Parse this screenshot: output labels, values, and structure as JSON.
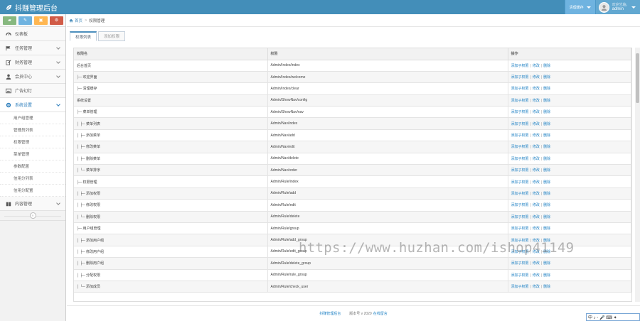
{
  "app": {
    "title": "抖赚管理后台"
  },
  "top": {
    "version_menu": "清理缓存",
    "greeting": "欢迎光临,",
    "username": "admin"
  },
  "colors": {
    "topbar": "#438eb9",
    "shortcut_green": "#87b87f",
    "shortcut_blue": "#6fb3e0",
    "shortcut_orange": "#ffb752",
    "shortcut_red": "#d15b47",
    "link": "#2283c5"
  },
  "shortcuts": [
    {
      "icon": "signal-icon",
      "glyph": "▰"
    },
    {
      "icon": "pencil-icon",
      "glyph": "✎"
    },
    {
      "icon": "group-icon",
      "glyph": "▣"
    },
    {
      "icon": "cog-icon",
      "glyph": "⚙"
    }
  ],
  "sidebar": {
    "dashboard": "仪表板",
    "task": "任务管理",
    "finance": "财务管理",
    "member": "会员中心",
    "ads": "广告幻灯",
    "system": "系统设置",
    "system_items": [
      "用户组管理",
      "管理员列表",
      "权限管理",
      "菜单管理",
      "参数配置",
      "信用分列表",
      "信用分配置"
    ],
    "content": "内容管理",
    "collapse": "«"
  },
  "breadcrumb": {
    "home": "首页",
    "current": "权限管理"
  },
  "tabs": {
    "list": "权限列表",
    "add": "添加权限"
  },
  "table": {
    "headers": [
      "权限名",
      "权限",
      "操作"
    ],
    "ops": {
      "add_child": "添加子权限",
      "edit": "修改",
      "delete": "删除"
    },
    "rows": [
      {
        "name": "后台首页",
        "path": "Admin/Index/index"
      },
      {
        "name": "├─ 欢迎界面",
        "path": "Admin/Index/welcome"
      },
      {
        "name": "├─ 清理缓存",
        "path": "Admin/Index/clear"
      },
      {
        "name": "系统设置",
        "path": "Admin/ShowNav/config"
      },
      {
        "name": "├─ 菜单管理",
        "path": "Admin/ShowNav/nav"
      },
      {
        "name": "│ ├─ 菜单列表",
        "path": "Admin/Nav/index"
      },
      {
        "name": "│ ├─ 添加菜单",
        "path": "Admin/Nav/add"
      },
      {
        "name": "│ ├─ 修改菜单",
        "path": "Admin/Nav/edit"
      },
      {
        "name": "│ ├─ 删除菜单",
        "path": "Admin/Nav/delete"
      },
      {
        "name": "│ └─ 菜单排序",
        "path": "Admin/Nav/order"
      },
      {
        "name": "├─ 权限管理",
        "path": "Admin/Rule/index"
      },
      {
        "name": "│ ├─ 添加权限",
        "path": "Admin/Rule/add"
      },
      {
        "name": "│ ├─ 修改权限",
        "path": "Admin/Rule/edit"
      },
      {
        "name": "│ └─ 删除权限",
        "path": "Admin/Rule/delete"
      },
      {
        "name": "├─ 用户组管理",
        "path": "Admin/Rule/group"
      },
      {
        "name": "│ ├─ 添加用户组",
        "path": "Admin/Rule/add_group"
      },
      {
        "name": "│ ├─ 修改用户组",
        "path": "Admin/Rule/edit_group"
      },
      {
        "name": "│ ├─ 删除用户组",
        "path": "Admin/Rule/delete_group"
      },
      {
        "name": "│ ├─ 分配权限",
        "path": "Admin/Rule/rule_group"
      },
      {
        "name": "│ └─ 添加成员",
        "path": "Admin/Rule/check_user"
      }
    ]
  },
  "footer": {
    "brand": "抖赚管理后台",
    "copyright": "版本号 v 2020",
    "link": "在线留言"
  },
  "watermark": "https://www.huzhan.com/ishop41149",
  "tool_strip": "中 ♪ ◦ 🎤 ⌨ ✦"
}
